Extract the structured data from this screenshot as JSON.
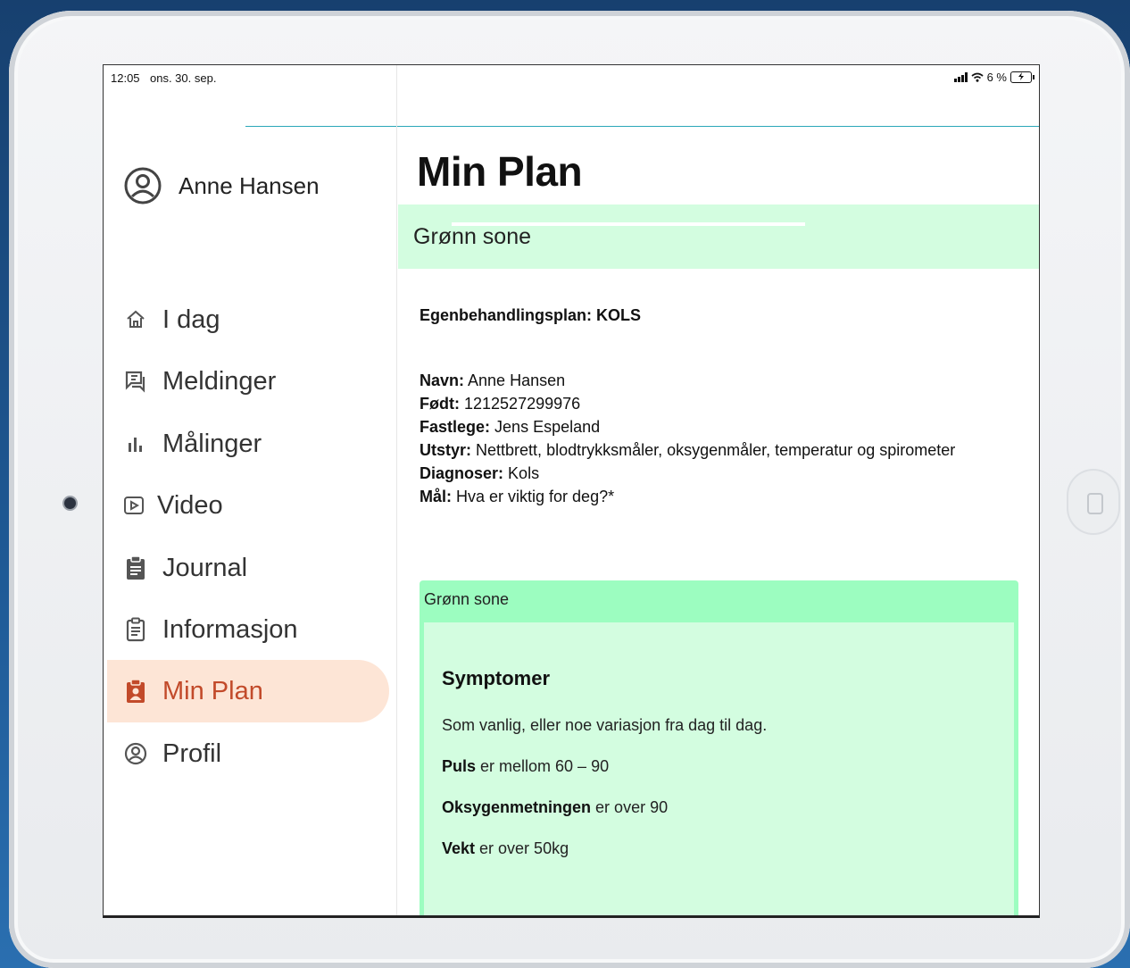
{
  "status": {
    "time": "12:05",
    "date": "ons. 30. sep.",
    "battery": "6 %"
  },
  "user": {
    "name": "Anne Hansen",
    "icon": "user-circle-icon"
  },
  "nav": [
    {
      "label": "I dag",
      "icon": "home-icon"
    },
    {
      "label": "Meldinger",
      "icon": "chat-icon"
    },
    {
      "label": "Målinger",
      "icon": "bar-chart-icon"
    },
    {
      "label": "Video",
      "icon": "play-icon"
    },
    {
      "label": "Journal",
      "icon": "clipboard-icon"
    },
    {
      "label": "Informasjon",
      "icon": "clipboard-list-icon"
    },
    {
      "label": "Min Plan",
      "icon": "clipboard-user-icon",
      "active": true
    },
    {
      "label": "Profil",
      "icon": "profile-icon"
    }
  ],
  "main": {
    "title": "Min Plan",
    "zone_header": "Grønn sone",
    "plan_title": "Egenbehandlingsplan: KOLS",
    "info": [
      {
        "label": "Navn:",
        "value": "Anne Hansen"
      },
      {
        "label": "Født:",
        "value": "1212527299976"
      },
      {
        "label": "Fastlege:",
        "value": "Jens Espeland"
      },
      {
        "label": "Utstyr:",
        "value": "Nettbrett, blodtrykksmåler, oksygenmåler, temperatur og spirometer"
      },
      {
        "label": "Diagnoser:",
        "value": "Kols"
      },
      {
        "label": "Mål:",
        "value": "Hva er viktig for deg?*"
      }
    ],
    "zone_card": {
      "label": "Grønn sone",
      "symptoms_title": "Symptomer",
      "symptoms_text": "Som vanlig, eller noe variasjon fra dag til dag.",
      "lines": [
        {
          "bold": "Puls",
          "rest": " er mellom 60 – 90"
        },
        {
          "bold": "Oksygenmetningen",
          "rest": " er over 90"
        },
        {
          "bold": "Vekt",
          "rest": " er over 50kg"
        }
      ]
    }
  },
  "colors": {
    "accent": "#c24a2a",
    "active_bg": "#fde5d6",
    "zone_green_light": "#d3fde0",
    "zone_green": "#9cfdc0"
  }
}
